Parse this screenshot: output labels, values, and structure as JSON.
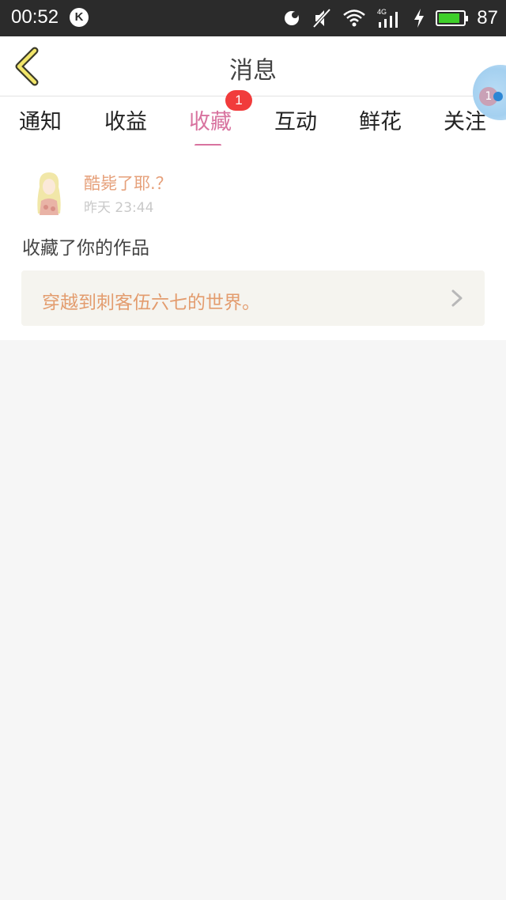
{
  "status_bar": {
    "time": "00:52",
    "notification_icon_letter": "K",
    "battery_percent": "87",
    "battery_level": 0.87,
    "battery_color": "#3ecf29"
  },
  "header": {
    "title": "消息"
  },
  "floating_bubble": {
    "badge": "1"
  },
  "tabs": [
    {
      "label": "通知",
      "active": false
    },
    {
      "label": "收益",
      "active": false
    },
    {
      "label": "收藏",
      "active": true,
      "badge": "1"
    },
    {
      "label": "互动",
      "active": false
    },
    {
      "label": "鲜花",
      "active": false
    },
    {
      "label": "关注",
      "active": false
    }
  ],
  "colors": {
    "accent_pink": "#d8739f",
    "badge_red": "#f13b3b",
    "username_orange": "#e6a07a",
    "work_title_orange": "#e39c6e"
  },
  "message": {
    "username": "酷毙了耶.？",
    "time": "昨天 23:44",
    "action": "收藏了你的作品",
    "work_title": "穿越到刺客伍六七的世界。"
  }
}
